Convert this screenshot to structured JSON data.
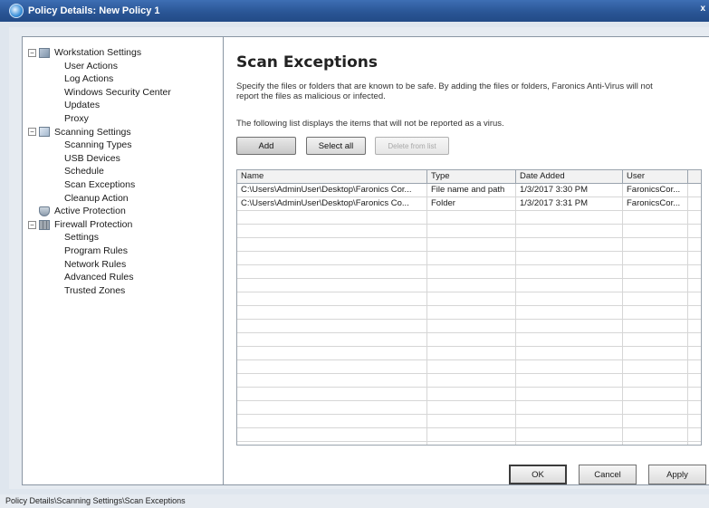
{
  "window": {
    "title": "Policy Details: New Policy 1",
    "close_glyph": "x"
  },
  "tree": [
    {
      "type": "group",
      "label": "Workstation Settings",
      "icon": "workstation-icon",
      "expander": "−"
    },
    {
      "type": "child",
      "label": "User Actions"
    },
    {
      "type": "child",
      "label": "Log Actions"
    },
    {
      "type": "child",
      "label": "Windows Security Center"
    },
    {
      "type": "child",
      "label": "Updates"
    },
    {
      "type": "child",
      "label": "Proxy"
    },
    {
      "type": "group",
      "label": "Scanning Settings",
      "icon": "scan-icon",
      "expander": "−"
    },
    {
      "type": "child",
      "label": "Scanning Types"
    },
    {
      "type": "child",
      "label": "USB Devices"
    },
    {
      "type": "child",
      "label": "Schedule"
    },
    {
      "type": "child",
      "label": "Scan Exceptions"
    },
    {
      "type": "child",
      "label": "Cleanup Action"
    },
    {
      "type": "leaf",
      "label": "Active Protection",
      "icon": "shield-icon"
    },
    {
      "type": "group",
      "label": "Firewall Protection",
      "icon": "firewall-icon",
      "expander": "−"
    },
    {
      "type": "child",
      "label": "Settings"
    },
    {
      "type": "child",
      "label": "Program Rules"
    },
    {
      "type": "child",
      "label": "Network Rules"
    },
    {
      "type": "child",
      "label": "Advanced Rules"
    },
    {
      "type": "child",
      "label": "Trusted Zones"
    }
  ],
  "content": {
    "heading": "Scan Exceptions",
    "description": "Specify the files or folders that are known to be safe. By adding the files or folders, Faronics Anti-Virus will not report the files as malicious or infected.",
    "list_info": "The following list displays the items that will not be reported as a virus.",
    "buttons": {
      "add": "Add",
      "select_all": "Select all",
      "delete": "Delete from list"
    }
  },
  "grid": {
    "columns": [
      "Name",
      "Type",
      "Date Added",
      "User"
    ],
    "rows": [
      [
        "C:\\Users\\AdminUser\\Desktop\\Faronics Cor...",
        "File name and path",
        "1/3/2017 3:30 PM",
        "FaronicsCor..."
      ],
      [
        "C:\\Users\\AdminUser\\Desktop\\Faronics  Co...",
        "Folder",
        "1/3/2017 3:31 PM",
        "FaronicsCor..."
      ]
    ],
    "empty_rows": 19
  },
  "footer": {
    "ok": "OK",
    "cancel": "Cancel",
    "apply": "Apply"
  },
  "status": "Policy Details\\Scanning Settings\\Scan Exceptions"
}
